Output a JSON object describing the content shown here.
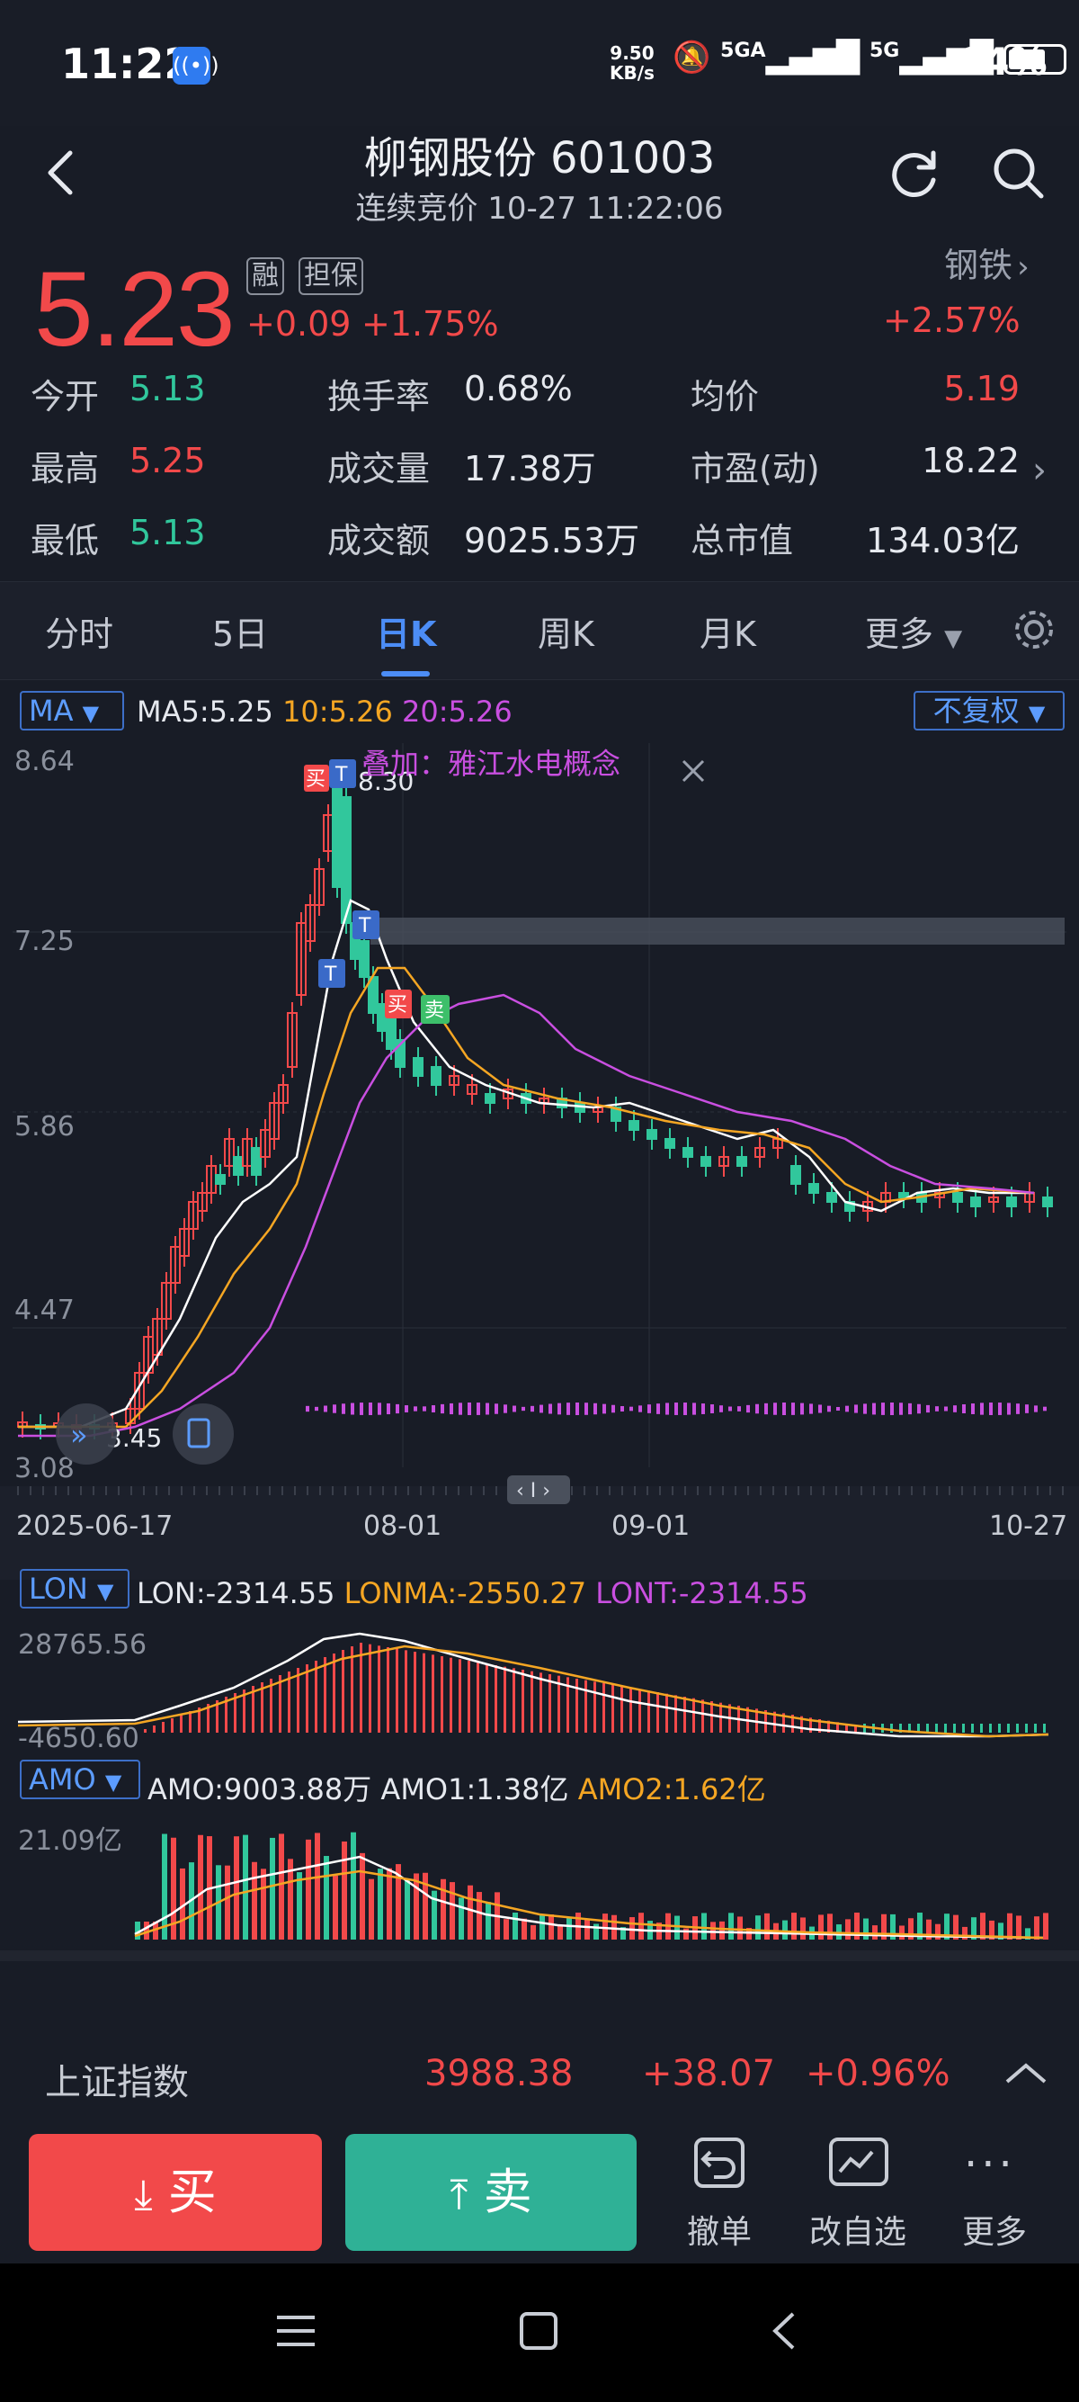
{
  "status_bar": {
    "time": "11:22",
    "net_speed_value": "9.50",
    "net_speed_unit": "KB/s",
    "network": "5GA",
    "network2": "5G",
    "battery": "64%"
  },
  "header": {
    "title": "柳钢股份 601003",
    "subtitle": "连续竞价 10-27 11:22:06"
  },
  "quote": {
    "price": "5.23",
    "tag_margin": "融",
    "tag_collateral": "担保",
    "change": "+0.09",
    "change_pct": "+1.75%",
    "sector": "钢铁",
    "sector_pct": "+2.57%",
    "stats": [
      {
        "label": "今开",
        "value": "5.13",
        "color": "green"
      },
      {
        "label": "换手率",
        "value": "0.68%",
        "color": "white"
      },
      {
        "label": "均价",
        "value": "5.19",
        "color": "red"
      },
      {
        "label": "最高",
        "value": "5.25",
        "color": "red"
      },
      {
        "label": "成交量",
        "value": "17.38万",
        "color": "white"
      },
      {
        "label": "市盈(动)",
        "value": "18.22",
        "color": "white"
      },
      {
        "label": "最低",
        "value": "5.13",
        "color": "green"
      },
      {
        "label": "成交额",
        "value": "9025.53万",
        "color": "white"
      },
      {
        "label": "总市值",
        "value": "134.03亿",
        "color": "white"
      }
    ]
  },
  "tabs": [
    "分时",
    "5日",
    "日K",
    "周K",
    "月K",
    "更多"
  ],
  "active_tab": "日K",
  "ma_bar": {
    "selector": "MA",
    "ma5": "MA5:5.25",
    "ma10": "10:5.26",
    "ma20": "20:5.26",
    "adjust": "不复权"
  },
  "kline": {
    "y_labels": [
      "8.64",
      "7.25",
      "5.86",
      "4.47",
      "3.08"
    ],
    "x_labels": [
      "2025-06-17",
      "08-01",
      "09-01",
      "10-27"
    ],
    "high_label": "8.30",
    "low_label": "3.45",
    "overlay_label": "叠加：雅江水电概念",
    "marker_buy": "买",
    "marker_sell": "卖",
    "marker_t": "T"
  },
  "lon": {
    "selector": "LON",
    "lon": "LON:-2314.55",
    "lonma": "LONMA:-2550.27",
    "lont": "LONT:-2314.55",
    "y_top": "28765.56",
    "y_bottom": "-4650.60"
  },
  "amo": {
    "selector": "AMO",
    "amo": "AMO:9003.88万",
    "amo1": "AMO1:1.38亿",
    "amo2": "AMO2:1.62亿",
    "y_top": "21.09亿"
  },
  "index_bar": {
    "name": "上证指数",
    "value": "3988.38",
    "change": "+38.07",
    "pct": "+0.96%"
  },
  "actions": {
    "buy": "买",
    "sell": "卖",
    "cancel": "撤单",
    "watchlist": "改自选",
    "more": "更多"
  },
  "colors": {
    "up": "#f2494a",
    "down": "#31c79c",
    "accent": "#4c8df6",
    "ma10": "#f5a623",
    "ma20": "#c94fe0"
  }
}
